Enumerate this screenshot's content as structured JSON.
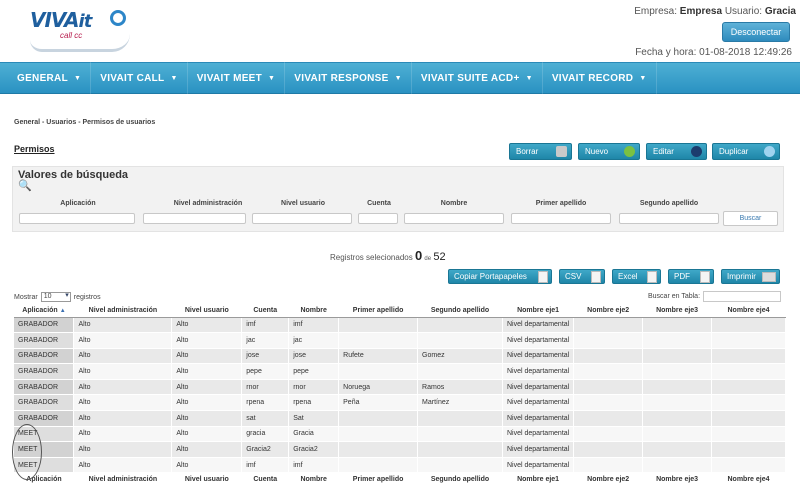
{
  "header": {
    "logo_main": "VIVA",
    "logo_it": "it",
    "logo_sub": "call cc",
    "empresa_label": "Empresa:",
    "empresa_value": "Empresa",
    "usuario_label": "Usuario:",
    "usuario_value": "Gracia",
    "disconnect_label": "Desconectar",
    "datetime_label": "Fecha y hora:",
    "datetime_value": "01-08-2018 12:49:26"
  },
  "nav": {
    "items": [
      {
        "label": "GENERAL"
      },
      {
        "label": "VIVAIT CALL"
      },
      {
        "label": "VIVAIT MEET"
      },
      {
        "label": "VIVAIT RESPONSE"
      },
      {
        "label": "VIVAIT SUITE ACD+"
      },
      {
        "label": "VIVAIT RECORD"
      }
    ]
  },
  "breadcrumb": "General - Usuarios - Permisos de usuarios",
  "page_title": "Permisos",
  "actions": {
    "borrar": "Borrar",
    "nuevo": "Nuevo",
    "editar": "Editar",
    "duplicar": "Duplicar"
  },
  "search": {
    "title": "Valores de búsqueda",
    "labels": [
      "Aplicación",
      "Nivel administración",
      "Nivel usuario",
      "Cuenta",
      "Nombre",
      "Primer apellido",
      "Segundo apellido"
    ],
    "button": "Buscar"
  },
  "records": {
    "prefix": "Registros selecionados",
    "selected": "0",
    "of": "de",
    "total": "52"
  },
  "export": {
    "copy": "Copiar Portapapeles",
    "csv": "CSV",
    "excel": "Excel",
    "pdf": "PDF",
    "print": "Imprimir"
  },
  "table_controls": {
    "show_label": "Mostrar",
    "show_value": "10",
    "show_suffix": "registros",
    "search_label": "Buscar en Tabla:"
  },
  "table": {
    "headers": [
      "Aplicación",
      "Nivel administración",
      "Nivel usuario",
      "Cuenta",
      "Nombre",
      "Primer apellido",
      "Segundo apellido",
      "Nombre eje1",
      "Nombre eje2",
      "Nombre eje3",
      "Nombre eje4"
    ],
    "rows": [
      [
        "GRABADOR",
        "Alto",
        "Alto",
        "imf",
        "imf",
        "",
        "",
        "Nivel departamental",
        "",
        "",
        ""
      ],
      [
        "GRABADOR",
        "Alto",
        "Alto",
        "jac",
        "jac",
        "",
        "",
        "Nivel departamental",
        "",
        "",
        ""
      ],
      [
        "GRABADOR",
        "Alto",
        "Alto",
        "jose",
        "jose",
        "Rufete",
        "Gomez",
        "Nivel departamental",
        "",
        "",
        ""
      ],
      [
        "GRABADOR",
        "Alto",
        "Alto",
        "pepe",
        "pepe",
        "",
        "",
        "Nivel departamental",
        "",
        "",
        ""
      ],
      [
        "GRABADOR",
        "Alto",
        "Alto",
        "rnor",
        "rnor",
        "Noruega",
        "Ramos",
        "Nivel departamental",
        "",
        "",
        ""
      ],
      [
        "GRABADOR",
        "Alto",
        "Alto",
        "rpena",
        "rpena",
        "Peña",
        "Martínez",
        "Nivel departamental",
        "",
        "",
        ""
      ],
      [
        "GRABADOR",
        "Alto",
        "Alto",
        "sat",
        "Sat",
        "",
        "",
        "Nivel departamental",
        "",
        "",
        ""
      ],
      [
        "MEET",
        "Alto",
        "Alto",
        "gracia",
        "Gracia",
        "",
        "",
        "Nivel departamental",
        "",
        "",
        ""
      ],
      [
        "MEET",
        "Alto",
        "Alto",
        "Gracia2",
        "Gracia2",
        "",
        "",
        "Nivel departamental",
        "",
        "",
        ""
      ],
      [
        "MEET",
        "Alto",
        "Alto",
        "imf",
        "imf",
        "",
        "",
        "Nivel departamental",
        "",
        "",
        ""
      ]
    ]
  }
}
